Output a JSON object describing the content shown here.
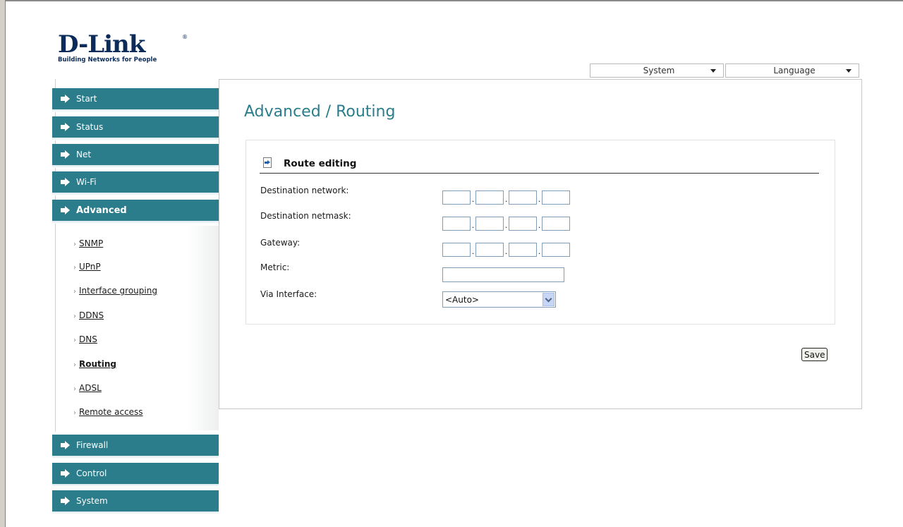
{
  "logo": {
    "brand": "D-Link",
    "registered": "®",
    "tagline": "Building Networks for People"
  },
  "top_menu": {
    "system": "System",
    "language": "Language"
  },
  "nav": {
    "start": "Start",
    "status": "Status",
    "net": "Net",
    "wifi": "Wi-Fi",
    "advanced": "Advanced",
    "firewall": "Firewall",
    "control": "Control",
    "system": "System"
  },
  "submenu": {
    "bullet": "›",
    "items": [
      "SNMP",
      "UPnP",
      "Interface grouping",
      "DDNS",
      "DNS",
      "Routing",
      "ADSL",
      "Remote access"
    ],
    "active": "Routing"
  },
  "page": {
    "title": "Advanced / Routing"
  },
  "section": {
    "title": "Route editing"
  },
  "form": {
    "destination_network_label": "Destination network:",
    "destination_netmask_label": "Destination netmask:",
    "gateway_label": "Gateway:",
    "metric_label": "Metric:",
    "via_interface_label": "Via Interface:",
    "via_interface_value": "<Auto>",
    "ip_separator": ".",
    "save_label": "Save"
  },
  "colors": {
    "accent": "#2b7d8c",
    "title": "#2b7d8c"
  },
  "icons": {
    "nav_arrow": "right-arrow-icon",
    "section": "edit-page-icon",
    "select": "chevron-down-icon"
  }
}
